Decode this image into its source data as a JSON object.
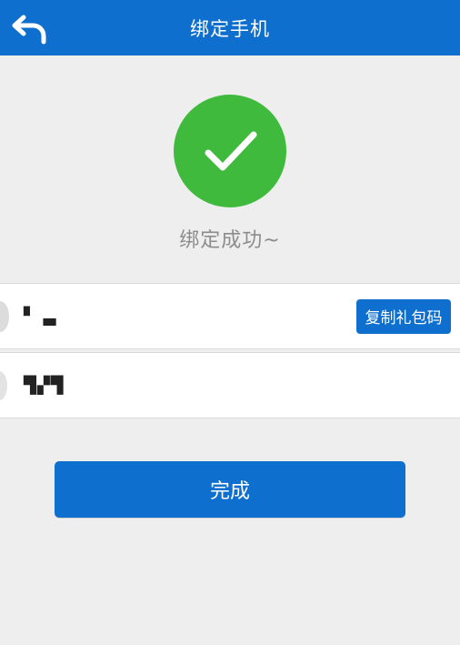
{
  "header": {
    "title": "绑定手机"
  },
  "success": {
    "message": "绑定成功~"
  },
  "gift": {
    "row1_value": "▘ ▃",
    "row1_button": "复制礼包码",
    "row2_value": "▜▞▜"
  },
  "action": {
    "done_label": "完成"
  },
  "colors": {
    "primary": "#0f6fcf",
    "success": "#3fba3d",
    "background": "#eeeeee"
  },
  "icons": {
    "back": "back-arrow-icon",
    "check": "checkmark-icon"
  }
}
